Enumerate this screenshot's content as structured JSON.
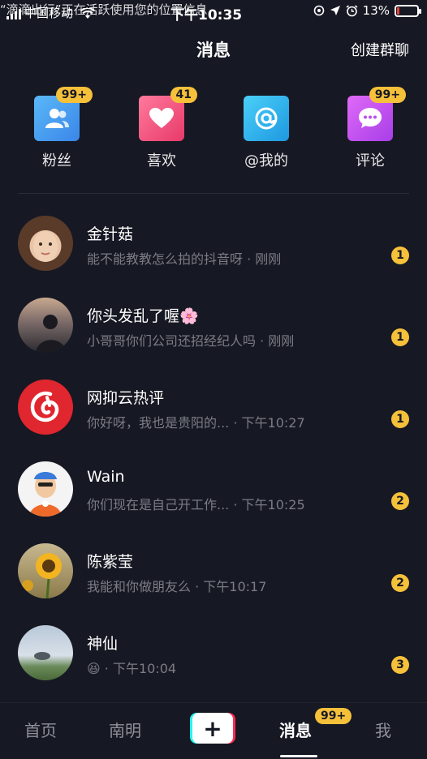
{
  "status_bar": {
    "carrier": "中国移动",
    "overlay_notice": "“滴滴出行”正在活跃使用您的位置信息",
    "time": "下午10:35",
    "battery_percent": "13%",
    "battery_level": 0.13,
    "battery_color": "#e8423a"
  },
  "header": {
    "title": "消息",
    "create_group_label": "创建群聊"
  },
  "quick_entries": [
    {
      "label": "粉丝",
      "badge": "99+",
      "icon": "fans-icon",
      "color": "#3aa0f0"
    },
    {
      "label": "喜欢",
      "badge": "41",
      "icon": "heart-icon",
      "color": "#f0507a"
    },
    {
      "label": "@我的",
      "badge": "",
      "icon": "at-icon",
      "color": "#25b8f0"
    },
    {
      "label": "评论",
      "badge": "99+",
      "icon": "comment-icon",
      "color": "#c84ef0"
    }
  ],
  "messages": [
    {
      "name": "金针菇",
      "preview": "能不能教教怎么拍的抖音呀 · 刚刚",
      "count": "1",
      "avatar": "girl-avatar"
    },
    {
      "name": "你头发乱了喔",
      "name_emoji": "🌸",
      "preview": "小哥哥你们公司还招经纪人吗 · 刚刚",
      "count": "1",
      "avatar": "silhouette-avatar"
    },
    {
      "name": "网抑云热评",
      "preview": "你好呀，我也是贵阳的... · 下午10:27",
      "count": "1",
      "avatar": "netease-logo-avatar"
    },
    {
      "name": "Wain",
      "preview": "你们现在是自己开工作... · 下午10:25",
      "count": "2",
      "avatar": "cartoon-avatar"
    },
    {
      "name": "陈紫莹",
      "preview": "我能和你做朋友么 · 下午10:17",
      "count": "2",
      "avatar": "sunflower-avatar"
    },
    {
      "name": "神仙",
      "preview_emoji": "😆",
      "preview": " · 下午10:04",
      "count": "3",
      "avatar": "sky-avatar"
    }
  ],
  "tabbar": {
    "home": "首页",
    "city": "南明",
    "add": "+",
    "messages": "消息",
    "messages_badge": "99+",
    "me": "我"
  }
}
